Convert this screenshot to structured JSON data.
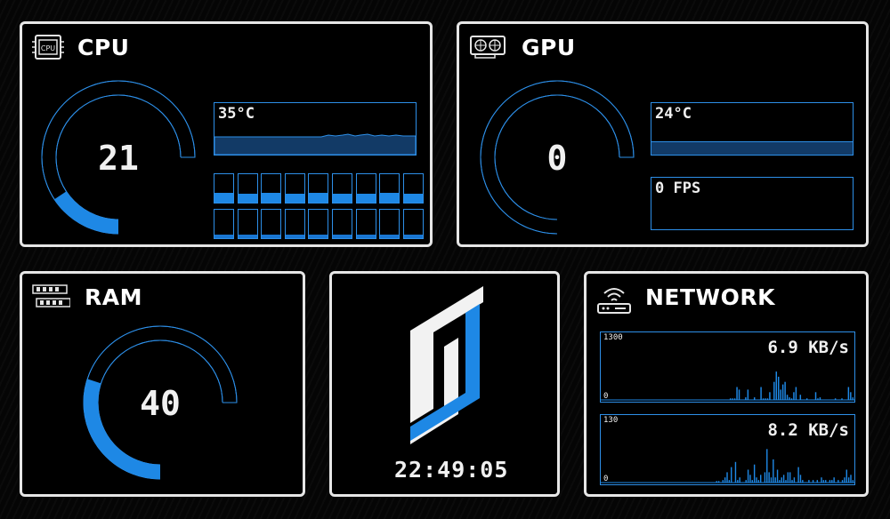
{
  "colors": {
    "accent": "#1e88e5",
    "panel_border": "#e6e6e6",
    "track": "#2d8fe8"
  },
  "cpu": {
    "title": "CPU",
    "icon": "cpu-chip-icon",
    "icon_text": "CPU",
    "usage": "21",
    "usage_fraction": 0.21,
    "temperature": "35°C",
    "cores_top": [
      0.35,
      0.3,
      0.35,
      0.3,
      0.35,
      0.3,
      0.3,
      0.35,
      0.3
    ],
    "cores_bottom": [
      0.12,
      0.12,
      0.12,
      0.12,
      0.12,
      0.12,
      0.12,
      0.12,
      0.12
    ]
  },
  "gpu": {
    "title": "GPU",
    "icon": "graphics-card-icon",
    "usage": "0",
    "usage_fraction": 0,
    "temperature": "24°C",
    "fps": "0 FPS"
  },
  "ram": {
    "title": "RAM",
    "icon": "memory-module-icon",
    "usage": "40",
    "usage_fraction": 0.4
  },
  "logo": {
    "icon": "tj-logo-icon",
    "time": "22:49:05"
  },
  "network": {
    "title": "NETWORK",
    "icon": "wifi-router-icon",
    "download": {
      "max_label": "1300",
      "min_label": "0",
      "rate": "6.9 KB/s",
      "samples": [
        0,
        0,
        0,
        0,
        0,
        0,
        0,
        0,
        0,
        0,
        0,
        0,
        0,
        0,
        0,
        0,
        0,
        0,
        0,
        0,
        0,
        0,
        0,
        0,
        0,
        0,
        0,
        0,
        0,
        0,
        0,
        0,
        0,
        0,
        0,
        0,
        0,
        0,
        0,
        0,
        0,
        0,
        0,
        0,
        0,
        0,
        0,
        0,
        0,
        0,
        0,
        0,
        0,
        0,
        0,
        0,
        0,
        0,
        0,
        0.03,
        0.03,
        0.03,
        0.25,
        0.2,
        0,
        0,
        0.05,
        0.2,
        0,
        0,
        0.05,
        0,
        0,
        0.25,
        0.03,
        0.03,
        0.03,
        0.15,
        0,
        0.35,
        0.55,
        0.45,
        0.2,
        0.3,
        0.35,
        0.1,
        0.05,
        0.03,
        0.15,
        0.25,
        0,
        0.1,
        0,
        0,
        0.03,
        0,
        0,
        0,
        0.15,
        0.03,
        0.05,
        0,
        0,
        0,
        0,
        0,
        0,
        0.03,
        0,
        0,
        0.03,
        0,
        0,
        0.25,
        0.15,
        0.05
      ]
    },
    "upload": {
      "max_label": "130",
      "min_label": "0",
      "rate": "8.2 KB/s",
      "samples": [
        0,
        0,
        0,
        0,
        0,
        0,
        0,
        0,
        0,
        0,
        0,
        0,
        0,
        0,
        0,
        0,
        0,
        0,
        0,
        0,
        0,
        0,
        0,
        0,
        0,
        0,
        0,
        0,
        0,
        0,
        0,
        0,
        0,
        0,
        0,
        0,
        0,
        0,
        0,
        0,
        0,
        0,
        0,
        0,
        0,
        0,
        0,
        0,
        0,
        0,
        0,
        0,
        0,
        0,
        0,
        0.03,
        0.03,
        0,
        0.05,
        0.1,
        0.2,
        0.05,
        0.3,
        0,
        0.4,
        0.05,
        0.1,
        0,
        0,
        0.05,
        0.25,
        0.15,
        0.05,
        0.35,
        0.1,
        0.05,
        0.15,
        0,
        0.2,
        0.65,
        0.2,
        0.1,
        0.45,
        0.1,
        0.25,
        0.05,
        0.1,
        0.15,
        0.05,
        0.2,
        0.2,
        0.05,
        0.1,
        0,
        0.3,
        0.15,
        0.05,
        0,
        0,
        0.05,
        0,
        0.05,
        0,
        0.05,
        0,
        0.1,
        0.05,
        0.05,
        0,
        0.05,
        0.05,
        0.1,
        0,
        0.05,
        0,
        0.05,
        0.1,
        0.25,
        0.1,
        0.15,
        0.05
      ]
    }
  }
}
